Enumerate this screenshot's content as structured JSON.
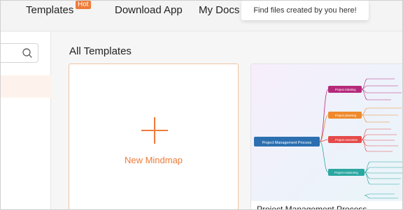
{
  "nav": {
    "templates": "Templates",
    "hot_badge": "Hot",
    "download_app": "Download App",
    "my_docs": "My Docs",
    "tooltip": "Find files created by you here!"
  },
  "search": {
    "placeholder": ""
  },
  "main": {
    "section_title": "All Templates",
    "new_mindmap_label": "New Mindmap",
    "template_card": {
      "title": "Project Management Process",
      "root_node": "Project Management Process",
      "branches": [
        {
          "label": "Project initiating",
          "color": "#b5297a"
        },
        {
          "label": "Project planning",
          "color": "#ee8a2c"
        },
        {
          "label": "Project execution",
          "color": "#e54a4a"
        },
        {
          "label": "Project monitoring",
          "color": "#2aa7a0"
        }
      ]
    }
  },
  "colors": {
    "accent": "#ee7b3a",
    "root_node": "#2c6fb0"
  }
}
